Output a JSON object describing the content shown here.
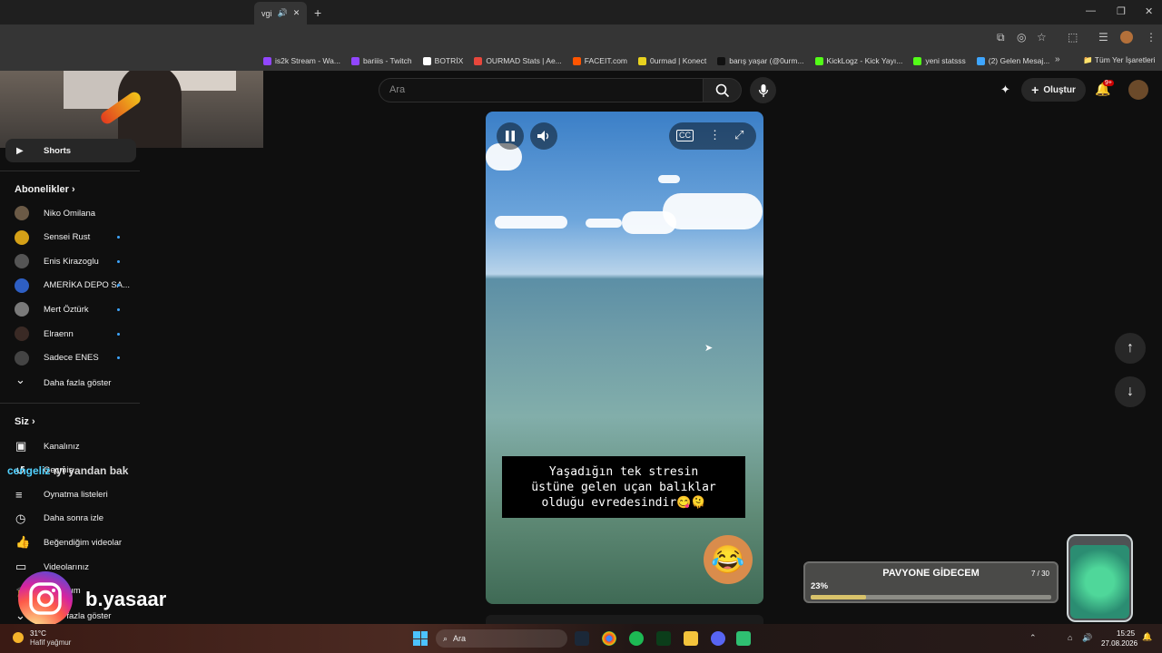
{
  "browser": {
    "tab_title": "vgi",
    "bookmarks": [
      {
        "label": "is2k Stream - Wa...",
        "color": "#9146ff"
      },
      {
        "label": "bariiis - Twitch",
        "color": "#9146ff"
      },
      {
        "label": "BOTRİX",
        "color": "#ffffff"
      },
      {
        "label": "OURMAD Stats | Ae...",
        "color": "#e8473c"
      },
      {
        "label": "FACEIT.com",
        "color": "#ff5500"
      },
      {
        "label": "0urmad | Konect",
        "color": "#e8d21f"
      },
      {
        "label": "barış yaşar (@0urm...",
        "color": "#111111"
      },
      {
        "label": "KickLogz - Kick Yayı...",
        "color": "#53fc18"
      },
      {
        "label": "yeni statsss",
        "color": "#53fc18"
      },
      {
        "label": "(2) Gelen Mesaj...",
        "color": "#3ea6ff"
      }
    ],
    "bookmarks_all": "Tüm Yer İşaretleri"
  },
  "header": {
    "search_placeholder": "Ara",
    "create_label": "Oluştur",
    "notif_badge": "9+"
  },
  "sidebar": {
    "shorts_label": "Shorts",
    "subs_heading": "Abonelikler",
    "subscriptions": [
      {
        "name": "Niko Omilana",
        "color": "#6b5a46",
        "live": false
      },
      {
        "name": "Sensei Rust",
        "color": "#d4a017",
        "live": true
      },
      {
        "name": "Enis Kirazoglu",
        "color": "#555555",
        "live": true
      },
      {
        "name": "AMERİKA DEPO SA...",
        "color": "#2e5fc4",
        "live": true
      },
      {
        "name": "Mert Öztürk",
        "color": "#7a7a7a",
        "live": true
      },
      {
        "name": "Elraenn",
        "color": "#3a2a25",
        "live": true
      },
      {
        "name": "Sadece ENES",
        "color": "#444444",
        "live": true
      }
    ],
    "show_more": "Daha fazla göster",
    "you_heading": "Siz",
    "you_items": [
      {
        "label": "Kanalınız",
        "icon": "person-box"
      },
      {
        "label": "Geçmiş",
        "icon": "history"
      },
      {
        "label": "Oynatma listeleri",
        "icon": "playlist"
      },
      {
        "label": "Daha sonra izle",
        "icon": "clock"
      },
      {
        "label": "Beğendiğim videolar",
        "icon": "thumbs-up"
      },
      {
        "label": "Videolarınız",
        "icon": "video"
      },
      {
        "label": "Kurslarım",
        "icon": "school"
      }
    ],
    "show_more_2": "Daha fazla göster"
  },
  "short": {
    "caption": "Yaşadığın tek stresin\nüstüne gelen uçan balıklar\nolduğu evredesindir😋🫠"
  },
  "overlay": {
    "chat_user": "cengeliz",
    "chat_text": "ıyi yandan bak",
    "instagram_handle": "b.yasaar",
    "goal_title": "PAVYONE GİDECEM",
    "goal_count": "7 / 30",
    "goal_percent": "23%",
    "goal_progress": 0.23
  },
  "taskbar": {
    "temperature": "31°C",
    "weather": "Hafif yağmur",
    "search": "Ara",
    "time": "15:25",
    "date": "27.08.2026"
  }
}
